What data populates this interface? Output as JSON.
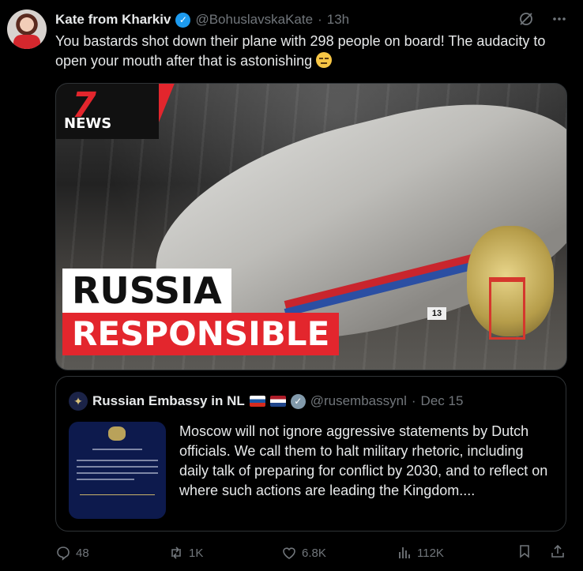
{
  "author": {
    "name": "Kate from Kharkiv",
    "handle": "@BohuslavskaKate",
    "separator": "·",
    "time": "13h"
  },
  "post": {
    "text": "You bastards shot down their plane with 298 people on board! The audacity to open your mouth after that is astonishing",
    "emoji": "unamused-face-icon"
  },
  "media": {
    "logo_number": "7",
    "logo_text": "NEWS",
    "headline_line1": "RUSSIA",
    "headline_line2": "RESPONSIBLE",
    "sign_number": "13"
  },
  "quoted": {
    "name": "Russian Embassy in NL",
    "handle": "@rusembassynl",
    "separator": "·",
    "date": "Dec 15",
    "text": "Moscow will not ignore aggressive statements by Dutch officials. We call them to halt military rhetoric, including daily talk of preparing for conflict by 2030, and to reflect on where such actions are leading the Kingdom...."
  },
  "stats": {
    "replies": "48",
    "reposts": "1K",
    "likes": "6.8K",
    "views": "112K"
  },
  "colors": {
    "background": "#000000",
    "text": "#e7e9ea",
    "muted": "#71767b",
    "verified_blue": "#1d9bf0",
    "border": "#2f3336"
  }
}
